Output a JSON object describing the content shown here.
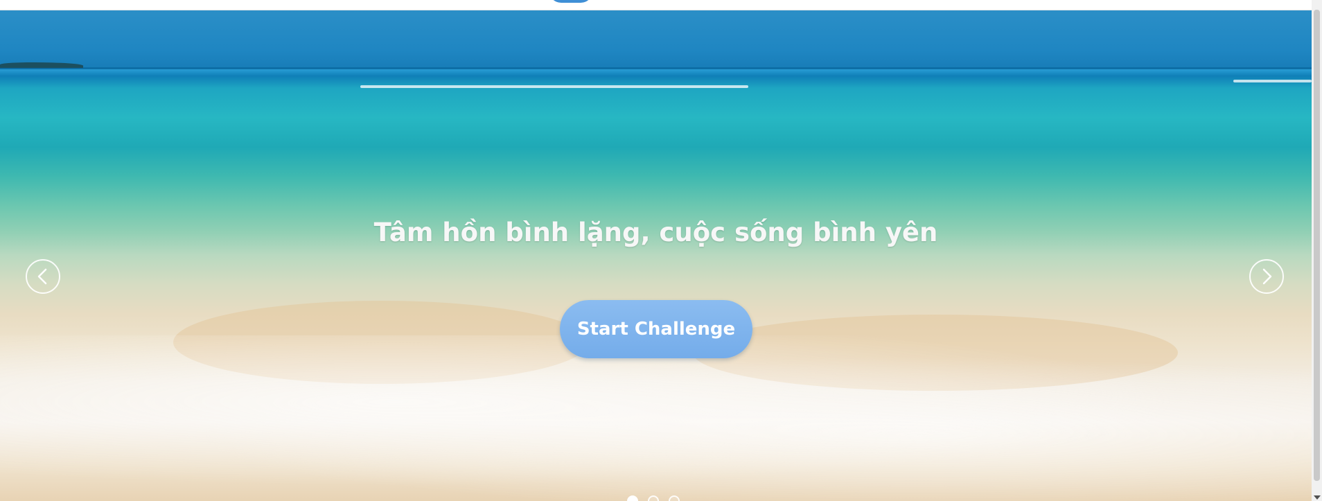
{
  "hero": {
    "title": "Tâm hồn bình lặng, cuộc sống bình yên",
    "cta_label": "Start Challenge",
    "prev_icon": "chevron-left-icon",
    "next_icon": "chevron-right-icon",
    "slide_count": 3,
    "active_slide": 1
  },
  "colors": {
    "cta_background": "#7ab2ec",
    "title_text": "#f7f7f7",
    "arrow_outline": "#ffffff"
  }
}
